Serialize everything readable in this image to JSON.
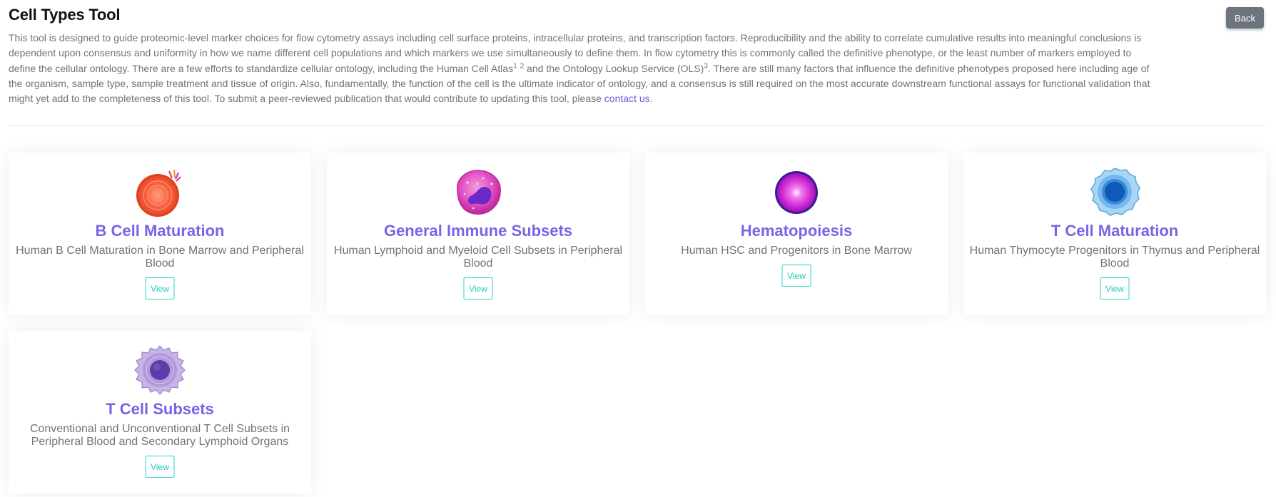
{
  "header": {
    "title": "Cell Types Tool",
    "back_label": "Back"
  },
  "intro": {
    "part1": "This tool is designed to guide proteomic-level marker choices for flow cytometry assays including cell surface proteins, intracellular proteins, and transcription factors. Reproducibility and the ability to correlate cumulative results into meaningful conclusions is dependent upon consensus and uniformity in how we name different cell populations and which markers we use simultaneously to define them. In flow cytometry this is commonly called the definitive phenotype, or the least number of markers employed to define the cellular ontology. There are a few efforts to standardize cellular ontology, including the Human Cell Atlas",
    "ref1": "1",
    "ref2": "2",
    "part2": " and the Ontology Lookup Service (OLS)",
    "ref3": "3",
    "part3": ". There are still many factors that influence the definitive phenotypes proposed here including age of the organism, sample type, sample treatment and tissue of origin. Also, fundamentally, the function of the cell is the ultimate indicator of ontology, and a consensus is still required on the most accurate downstream functional assays for functional validation that might yet add to the completeness of this tool. To submit a peer-reviewed publication that would contribute to updating this tool, please ",
    "link": "contact us",
    "end": "."
  },
  "cards": [
    {
      "title": "B Cell Maturation",
      "description": "Human B Cell Maturation in Bone Marrow and Peripheral Blood",
      "view_label": "View",
      "icon": "b-cell-icon",
      "color": "#f25a3a"
    },
    {
      "title": "General Immune Subsets",
      "description": "Human Lymphoid and Myeloid Cell Subsets in Peripheral Blood",
      "view_label": "View",
      "icon": "neutrophil-icon",
      "color": "#d936b8"
    },
    {
      "title": "Hematopoiesis",
      "description": "Human HSC and Progenitors in Bone Marrow",
      "view_label": "View",
      "icon": "stem-cell-icon",
      "color": "#c62ad6"
    },
    {
      "title": "T Cell Maturation",
      "description": "Human Thymocyte Progenitors in Thymus and Peripheral Blood",
      "view_label": "View",
      "icon": "thymocyte-icon",
      "color": "#3a94d8"
    },
    {
      "title": "T Cell Subsets",
      "description": "Conventional and Unconventional T Cell Subsets in Peripheral Blood and Secondary Lymphoid Organs",
      "view_label": "View",
      "icon": "t-cell-icon",
      "color": "#8c6cc4"
    }
  ]
}
